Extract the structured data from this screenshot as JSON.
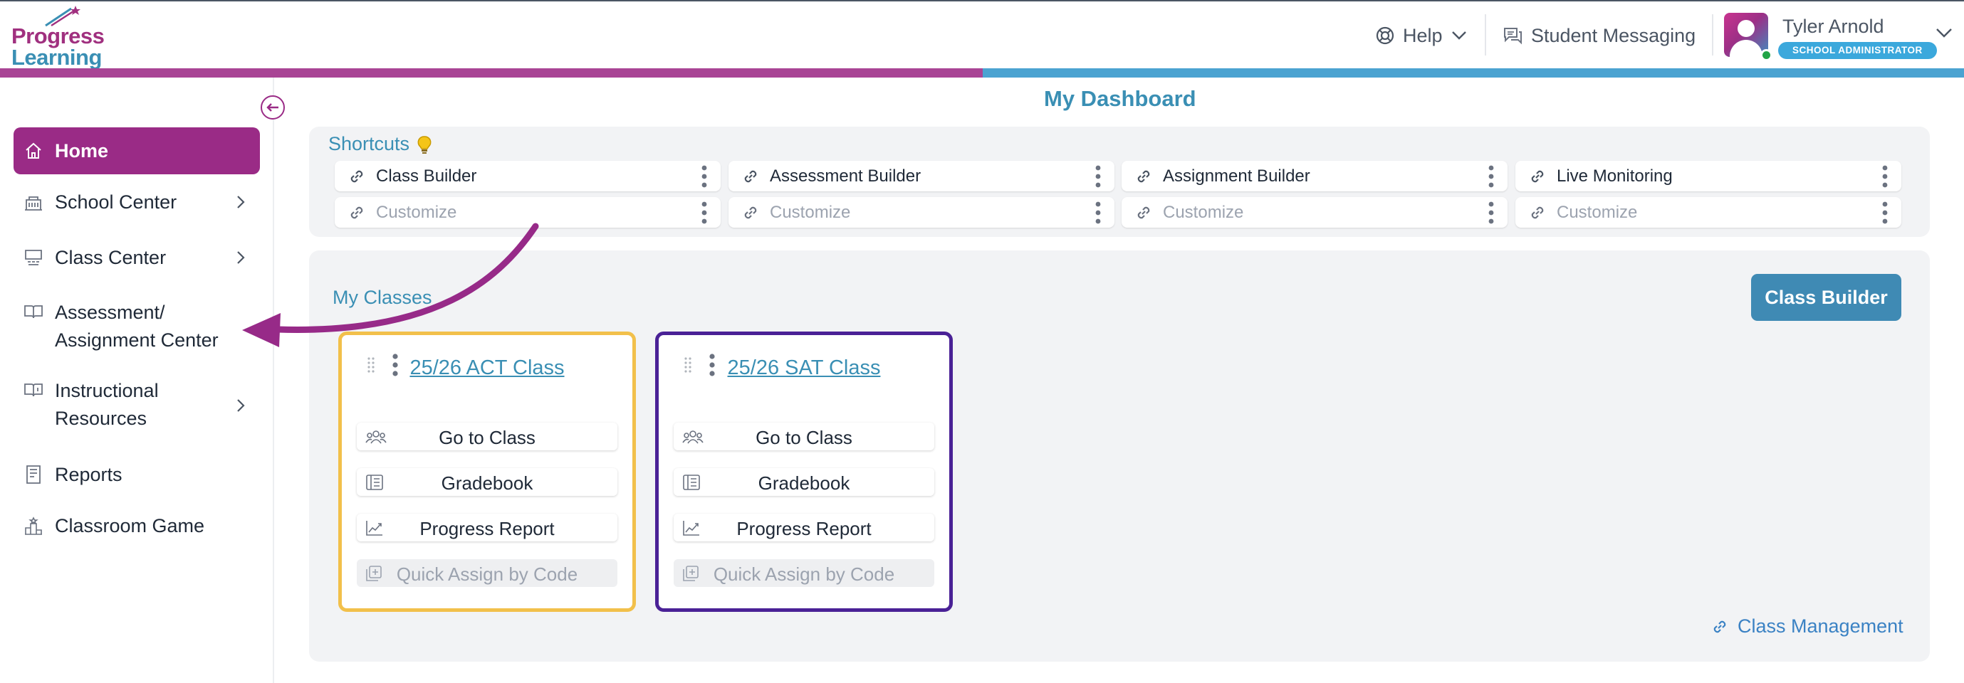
{
  "app": {
    "logo_line1": "Progress",
    "logo_line2": "Learning",
    "brand_colors": {
      "magenta": "#9a2b86",
      "blue": "#3a8fb4",
      "stripe_left": "#a94495",
      "stripe_right": "#4ba3d1"
    }
  },
  "header": {
    "help_label": "Help",
    "messaging_label": "Student Messaging",
    "user_name": "Tyler Arnold",
    "user_role": "SCHOOL ADMINISTRATOR"
  },
  "sidebar": {
    "items": [
      {
        "label": "Home",
        "icon": "home-icon",
        "active": true,
        "has_submenu": false
      },
      {
        "label": "School Center",
        "icon": "school-icon",
        "active": false,
        "has_submenu": true
      },
      {
        "label": "Class Center",
        "icon": "classroom-icon",
        "active": false,
        "has_submenu": true
      },
      {
        "label_line1": "Assessment/",
        "label_line2": "Assignment Center",
        "icon": "book-open-icon",
        "active": false,
        "has_submenu": false
      },
      {
        "label_line1": "Instructional",
        "label_line2": "Resources",
        "icon": "book-info-icon",
        "active": false,
        "has_submenu": true
      },
      {
        "label": "Reports",
        "icon": "report-icon",
        "active": false,
        "has_submenu": false
      },
      {
        "label": "Classroom Game",
        "icon": "podium-icon",
        "active": false,
        "has_submenu": false
      }
    ]
  },
  "main": {
    "title": "My Dashboard",
    "shortcuts": {
      "title": "Shortcuts",
      "items": [
        {
          "label": "Class Builder",
          "placeholder": false
        },
        {
          "label": "Assessment Builder",
          "placeholder": false
        },
        {
          "label": "Assignment Builder",
          "placeholder": false
        },
        {
          "label": "Live Monitoring",
          "placeholder": false
        },
        {
          "label": "Customize",
          "placeholder": true
        },
        {
          "label": "Customize",
          "placeholder": true
        },
        {
          "label": "Customize",
          "placeholder": true
        },
        {
          "label": "Customize",
          "placeholder": true
        }
      ]
    },
    "my_classes": {
      "title": "My Classes",
      "class_builder_button": "Class Builder",
      "cards": [
        {
          "name": "25/26 ACT Class",
          "border_color": "#f2c04b",
          "actions": [
            "Go to Class",
            "Gradebook",
            "Progress Report",
            "Quick Assign by Code"
          ]
        },
        {
          "name": "25/26 SAT Class",
          "border_color": "#4a2196",
          "actions": [
            "Go to Class",
            "Gradebook",
            "Progress Report",
            "Quick Assign by Code"
          ]
        }
      ],
      "class_management_link": "Class Management"
    }
  },
  "annotation": {
    "arrow_color": "#972a88"
  }
}
